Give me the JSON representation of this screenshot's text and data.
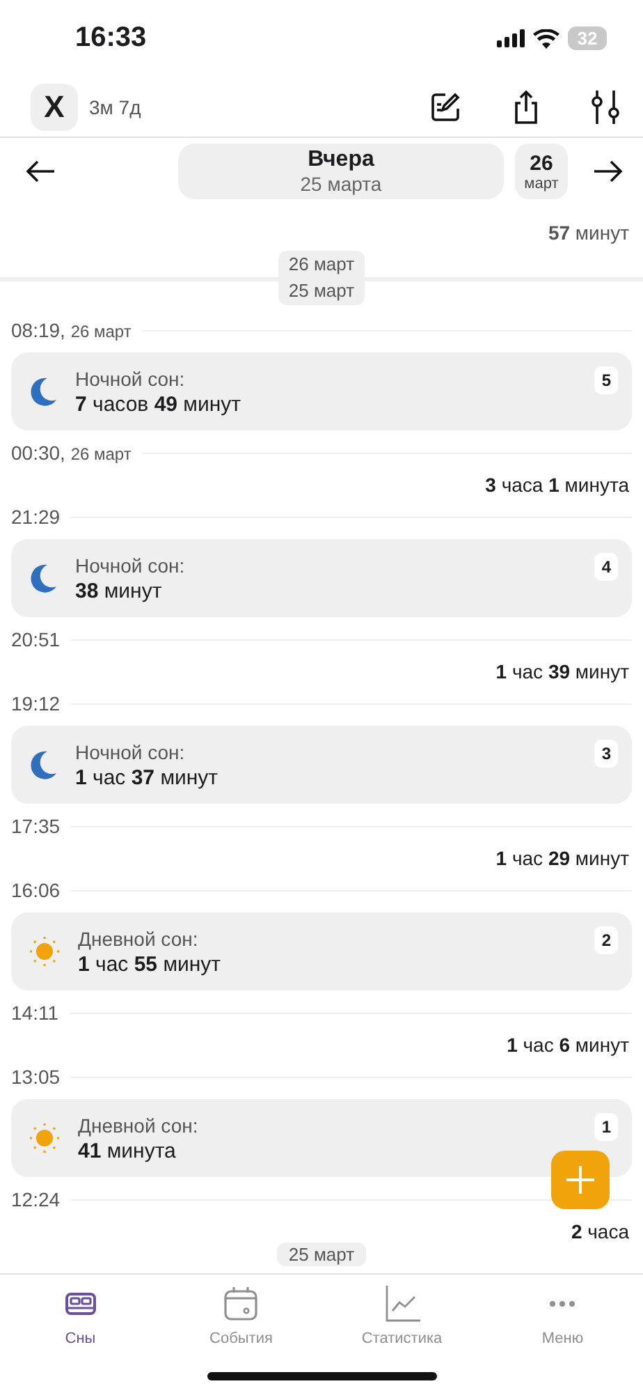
{
  "status_bar": {
    "time": "16:33",
    "battery": "32"
  },
  "toolbar": {
    "child_initial": "X",
    "age": "3м 7д"
  },
  "date_nav": {
    "title": "Вчера",
    "subtitle": "25 марта",
    "next_day": "26",
    "next_month": "март"
  },
  "top_gap": "**57** минут",
  "day_divider": [
    "26 март",
    "25 март"
  ],
  "timeline": [
    {
      "kind": "time",
      "time": "08:19,",
      "date": "26 март"
    },
    {
      "kind": "night",
      "label": "Ночной сон:",
      "duration": "**7** часов **49** минут",
      "number": "5"
    },
    {
      "kind": "time",
      "time": "00:30,",
      "date": "26 март"
    },
    {
      "kind": "gap",
      "duration": "**3** часа **1** минута"
    },
    {
      "kind": "time",
      "time": "21:29"
    },
    {
      "kind": "night",
      "label": "Ночной сон:",
      "duration": "**38** минут",
      "number": "4"
    },
    {
      "kind": "time",
      "time": "20:51"
    },
    {
      "kind": "gap",
      "duration": "**1** час **39** минут"
    },
    {
      "kind": "time",
      "time": "19:12"
    },
    {
      "kind": "night",
      "label": "Ночной сон:",
      "duration": "**1** час **37** минут",
      "number": "3"
    },
    {
      "kind": "time",
      "time": "17:35"
    },
    {
      "kind": "gap",
      "duration": "**1** час **29** минут"
    },
    {
      "kind": "time",
      "time": "16:06"
    },
    {
      "kind": "day",
      "label": "Дневной сон:",
      "duration": "**1** час **55** минут",
      "number": "2"
    },
    {
      "kind": "time",
      "time": "14:11"
    },
    {
      "kind": "gap",
      "duration": "**1** час **6** минут"
    },
    {
      "kind": "time",
      "time": "13:05"
    },
    {
      "kind": "day",
      "label": "Дневной сон:",
      "duration": "**41** минута",
      "number": "1"
    },
    {
      "kind": "time",
      "time": "12:24"
    },
    {
      "kind": "gap",
      "duration": "**2** часа"
    }
  ],
  "bottom_divider": "25 март",
  "tabs": [
    {
      "label": "Сны",
      "selected": true
    },
    {
      "label": "События",
      "selected": false
    },
    {
      "label": "Статистика",
      "selected": false
    },
    {
      "label": "Меню",
      "selected": false
    }
  ]
}
